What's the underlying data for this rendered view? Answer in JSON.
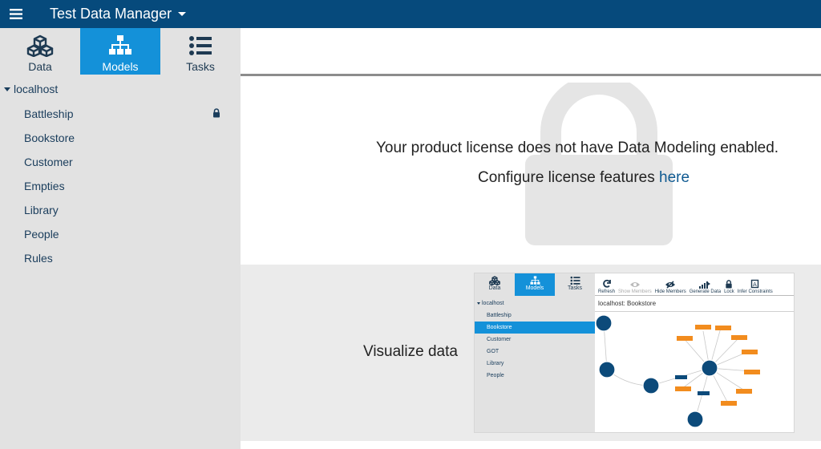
{
  "header": {
    "title": "Test Data Manager"
  },
  "sidebar": {
    "tabs": [
      {
        "label": "Data"
      },
      {
        "label": "Models"
      },
      {
        "label": "Tasks"
      }
    ],
    "root": "localhost",
    "items": [
      {
        "label": "Battleship",
        "locked": true
      },
      {
        "label": "Bookstore"
      },
      {
        "label": "Customer"
      },
      {
        "label": "Empties"
      },
      {
        "label": "Library"
      },
      {
        "label": "People"
      },
      {
        "label": "Rules"
      }
    ]
  },
  "main": {
    "license_message": "Your product license does not have Data Modeling enabled.",
    "configure_prefix": "Configure license features ",
    "configure_link": "here",
    "visualize_label": "Visualize data"
  },
  "preview": {
    "tabs": [
      "Data",
      "Models",
      "Tasks"
    ],
    "root": "localhost",
    "items": [
      "Battleship",
      "Bookstore",
      "Customer",
      "GOT",
      "Library",
      "People"
    ],
    "selected_item": "Bookstore",
    "toolbar": [
      "Refresh",
      "Show Members",
      "Hide Members",
      "Generate Data",
      "Lock",
      "Infer Constraints"
    ],
    "breadcrumb": "localhost: Bookstore"
  },
  "colors": {
    "header": "#064a7c",
    "active_tab": "#1491d9",
    "sidebar_bg": "#e2e2e2",
    "link": "#0f5a91",
    "node": "#0c4a7a",
    "edge_label": "#f28c1e"
  }
}
